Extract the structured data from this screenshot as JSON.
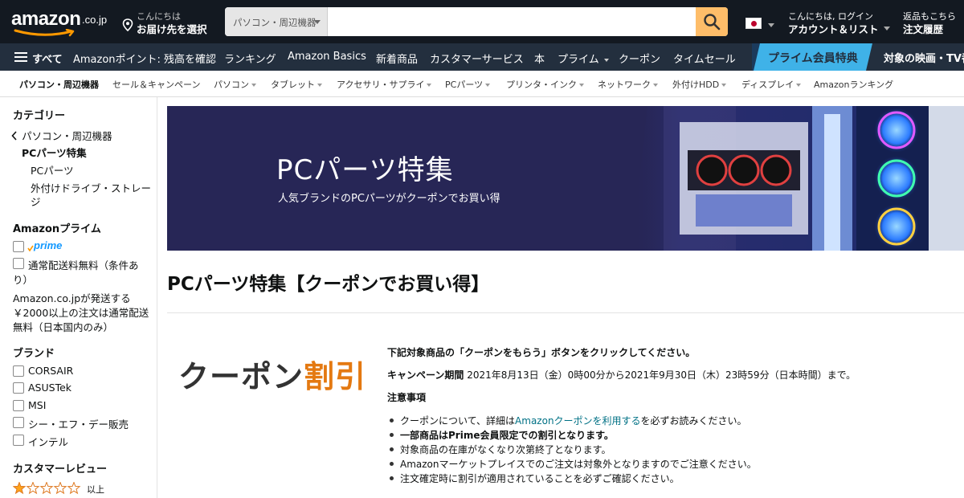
{
  "header": {
    "logo_text": "amazon",
    "logo_domain": ".co.jp",
    "deliver_line1": "こんにちは",
    "deliver_line2": "お届け先を選択",
    "search_category": "パソコン・周辺機器",
    "search_placeholder": "",
    "account_line1": "こんにちは, ログイン",
    "account_line2": "アカウント＆リスト",
    "orders_line1": "返品もこちら",
    "orders_line2": "注文履歴",
    "icons": [
      "location-pin-icon",
      "search-icon",
      "japan-flag-icon"
    ]
  },
  "main_nav": {
    "all_label": "すべて",
    "items": [
      "Amazonポイント: 残高を確認",
      "ランキング",
      "Amazon Basics",
      "新着商品",
      "カスタマーサービス",
      "本",
      "プライム",
      "クーポン",
      "タイムセール"
    ],
    "promo_label": "プライム会員特典",
    "promo_text": "対象の映画・TV番"
  },
  "sub_nav": {
    "items": [
      "パソコン・周辺機器",
      "セール＆キャンペーン",
      "パソコン",
      "タブレット",
      "アクセサリ・サプライ",
      "PCパーツ",
      "プリンタ・インク",
      "ネットワーク",
      "外付けHDD",
      "ディスプレイ",
      "Amazonランキング"
    ]
  },
  "sidebar": {
    "category_heading": "カテゴリー",
    "category_back": "パソコン・周辺機器",
    "category_current": "PCパーツ特集",
    "category_children": [
      "PCパーツ",
      "外付けドライブ・ストレー",
      "ジ"
    ],
    "prime_heading": "Amazonプライム",
    "prime_logo": "prime",
    "free_shipping_line1": "通常配送料無料（条件あ",
    "free_shipping_line2": "り）",
    "shipping_note_lines": [
      "Amazon.co.jpが発送する",
      "￥2000以上の注文は通常配送",
      "無料（日本国内のみ）"
    ],
    "brand_heading": "ブランド",
    "brands": [
      "CORSAIR",
      "ASUSTek",
      "MSI",
      "シー・エフ・デー販売",
      "インテル"
    ],
    "review_heading": "カスタマーレビュー",
    "review_and_up": "以上",
    "review_rating": 1
  },
  "banner": {
    "title": "PCパーツ特集",
    "subtitle": "人気ブランドのPCパーツがクーポンでお買い得"
  },
  "content": {
    "page_title": "PCパーツ特集【クーポンでお買い得】",
    "coupon_art_a": "クーポン",
    "coupon_art_b": "割引",
    "instruction": "下記対象商品の「クーポンをもらう」ボタンをクリックしてください。",
    "period_label": "キャンペーン期間",
    "period_value": "2021年8月13日（金）0時00分から2021年9月30日（木）23時59分（日本時間）まで。",
    "notes_heading": "注意事項",
    "note1_pre": "クーポンについて、詳細は",
    "note1_link": "Amazonクーポンを利用する",
    "note1_post": "を必ずお読みください。",
    "note2": "一部商品はPrime会員限定での割引となります。",
    "note3": "対象商品の在庫がなくなり次第終了となります。",
    "note4": "Amazonマーケットプレイスでのご注文は対象外となりますのでご注意ください。",
    "note5": "注文確定時に割引が適用されていることを必ずご確認ください。"
  },
  "colors": {
    "nav_top": "#131921",
    "nav_main": "#232f3e",
    "search_button": "#febd69",
    "banner_bg": "#272656",
    "accent_orange": "#e47911",
    "link": "#007185",
    "prime_blue": "#1399ff"
  }
}
